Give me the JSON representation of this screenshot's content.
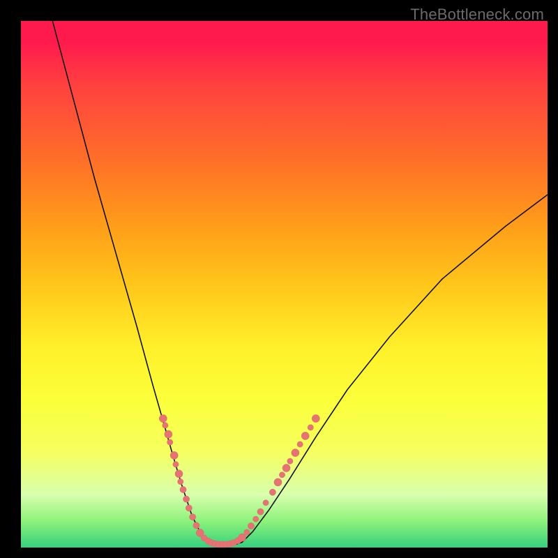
{
  "watermark": {
    "text": "TheBottleneck.com"
  },
  "colors": {
    "curve_stroke": "#111111",
    "marker_fill": "#e57373",
    "marker_stroke": "#d86666",
    "gradient_stops": [
      "#ff1a4d",
      "#ff4040",
      "#ff6a2a",
      "#ff9a1a",
      "#ffc61a",
      "#fff02a",
      "#fbff3a",
      "#f5ff60",
      "#d8ffae",
      "#8cf27a",
      "#35d07e"
    ]
  },
  "chart_data": {
    "type": "line",
    "title": "",
    "xlabel": "",
    "ylabel": "",
    "xlim": [
      0,
      100
    ],
    "ylim": [
      0,
      100
    ],
    "series": [
      {
        "name": "bottleneck-curve",
        "x": [
          6,
          10,
          14,
          18,
          22,
          25,
          27,
          29,
          30.5,
          31.5,
          32.5,
          33.5,
          34.5,
          36,
          37.5,
          39,
          40.5,
          42,
          44,
          47,
          51,
          56,
          62,
          70,
          80,
          92,
          100
        ],
        "y": [
          100,
          85,
          70,
          56,
          42,
          31,
          24,
          17,
          12,
          9,
          6,
          4,
          2,
          1,
          0.5,
          0.5,
          0.5,
          1,
          3,
          7,
          13,
          21,
          30,
          40,
          51,
          61,
          67
        ]
      }
    ],
    "markers": [
      {
        "name": "left-cluster",
        "points": [
          {
            "x": 27.0,
            "y": 24.5,
            "r": 1.2
          },
          {
            "x": 27.4,
            "y": 23.2,
            "r": 0.9
          },
          {
            "x": 28.0,
            "y": 21.5,
            "r": 1.2
          },
          {
            "x": 28.3,
            "y": 20.0,
            "r": 0.9
          },
          {
            "x": 29.1,
            "y": 17.5,
            "r": 1.2
          },
          {
            "x": 29.4,
            "y": 15.8,
            "r": 0.9
          },
          {
            "x": 30.0,
            "y": 14.0,
            "r": 1.2
          },
          {
            "x": 30.3,
            "y": 12.5,
            "r": 0.9
          },
          {
            "x": 30.8,
            "y": 11.0,
            "r": 1.0
          },
          {
            "x": 31.4,
            "y": 9.2,
            "r": 1.0
          },
          {
            "x": 31.9,
            "y": 7.5,
            "r": 1.0
          },
          {
            "x": 32.6,
            "y": 5.8,
            "r": 1.0
          },
          {
            "x": 33.3,
            "y": 4.2,
            "r": 1.0
          },
          {
            "x": 34.0,
            "y": 2.8,
            "r": 1.2
          }
        ]
      },
      {
        "name": "floor-cluster",
        "points": [
          {
            "x": 34.8,
            "y": 1.8,
            "r": 1.0
          },
          {
            "x": 35.6,
            "y": 1.2,
            "r": 1.0
          },
          {
            "x": 36.2,
            "y": 0.9,
            "r": 1.0
          },
          {
            "x": 36.9,
            "y": 0.7,
            "r": 1.0
          },
          {
            "x": 37.6,
            "y": 0.6,
            "r": 1.0
          },
          {
            "x": 38.3,
            "y": 0.6,
            "r": 1.0
          },
          {
            "x": 39.0,
            "y": 0.6,
            "r": 1.0
          },
          {
            "x": 39.7,
            "y": 0.7,
            "r": 1.0
          },
          {
            "x": 40.4,
            "y": 0.9,
            "r": 1.0
          },
          {
            "x": 41.2,
            "y": 1.3,
            "r": 1.0
          },
          {
            "x": 42.0,
            "y": 1.9,
            "r": 1.2
          }
        ]
      },
      {
        "name": "right-cluster",
        "points": [
          {
            "x": 42.9,
            "y": 2.9,
            "r": 0.9
          },
          {
            "x": 43.7,
            "y": 4.1,
            "r": 1.0
          },
          {
            "x": 44.6,
            "y": 5.4,
            "r": 0.9
          },
          {
            "x": 45.5,
            "y": 6.8,
            "r": 1.0
          },
          {
            "x": 46.5,
            "y": 8.5,
            "r": 0.9
          },
          {
            "x": 47.8,
            "y": 10.5,
            "r": 1.0
          },
          {
            "x": 48.8,
            "y": 12.4,
            "r": 1.2
          },
          {
            "x": 49.6,
            "y": 13.8,
            "r": 0.9
          },
          {
            "x": 50.4,
            "y": 15.1,
            "r": 1.2
          },
          {
            "x": 51.1,
            "y": 16.4,
            "r": 0.9
          },
          {
            "x": 52.1,
            "y": 18.0,
            "r": 1.2
          },
          {
            "x": 53.0,
            "y": 19.6,
            "r": 0.9
          },
          {
            "x": 54.0,
            "y": 21.2,
            "r": 1.2
          },
          {
            "x": 55.0,
            "y": 22.8,
            "r": 0.9
          },
          {
            "x": 56.0,
            "y": 24.5,
            "r": 1.2
          }
        ]
      }
    ]
  }
}
